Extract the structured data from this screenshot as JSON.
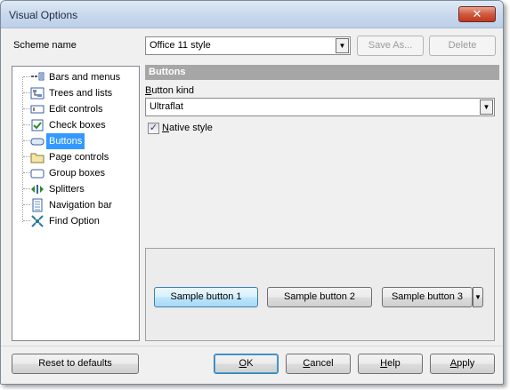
{
  "window": {
    "title": "Visual Options",
    "close_glyph": "✕"
  },
  "scheme": {
    "label": "Scheme name",
    "value": "Office 11 style",
    "save_as": "Save As...",
    "delete": "Delete"
  },
  "tree": {
    "items": [
      {
        "label": "Bars and menus",
        "icon": "bars-menus-icon",
        "selected": false
      },
      {
        "label": "Trees and lists",
        "icon": "tree-list-icon",
        "selected": false
      },
      {
        "label": "Edit controls",
        "icon": "edit-control-icon",
        "selected": false
      },
      {
        "label": "Check boxes",
        "icon": "checkbox-icon",
        "selected": false
      },
      {
        "label": "Buttons",
        "icon": "button-icon",
        "selected": true
      },
      {
        "label": "Page controls",
        "icon": "folder-icon",
        "selected": false
      },
      {
        "label": "Group boxes",
        "icon": "group-box-icon",
        "selected": false
      },
      {
        "label": "Splitters",
        "icon": "splitter-icon",
        "selected": false
      },
      {
        "label": "Navigation bar",
        "icon": "navigation-bar-icon",
        "selected": false
      },
      {
        "label": "Find Option",
        "icon": "find-option-icon",
        "selected": false
      }
    ]
  },
  "panel": {
    "header": "Buttons",
    "button_kind_label_u": "B",
    "button_kind_label_rest": "utton kind",
    "button_kind_value": "Ultraflat",
    "native_style_u": "N",
    "native_style_rest": "ative style",
    "native_style_checked": true,
    "samples": [
      "Sample button 1",
      "Sample button 2",
      "Sample button 3"
    ]
  },
  "footer": {
    "reset": "Reset to defaults",
    "ok": "OK",
    "cancel_u": "C",
    "cancel_rest": "ancel",
    "help_u": "H",
    "help_rest": "elp",
    "apply_u": "A",
    "apply_rest": "pply",
    "ok_u": "O",
    "ok_rest": "K"
  },
  "colors": {
    "selection": "#3399ff",
    "section_header": "#a6a6a6",
    "close_button": "#c0391f"
  }
}
